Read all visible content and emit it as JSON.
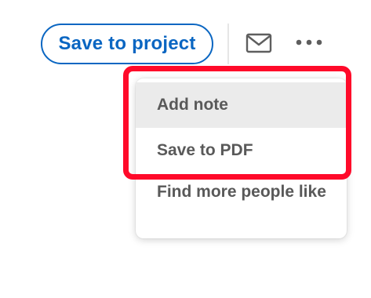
{
  "header": {
    "save_to_project_label": "Save to project",
    "mail_icon": "envelope-icon",
    "more_icon": "more-horizontal-icon"
  },
  "dropdown": {
    "items": [
      {
        "label": "Add note",
        "highlighted": true
      },
      {
        "label": "Save to PDF",
        "highlighted": false
      },
      {
        "label": "Find more people like",
        "highlighted": false
      }
    ]
  },
  "colors": {
    "accent": "#0a66c2",
    "menu_text": "#595959",
    "hover_bg": "#ebebeb",
    "annotation_red": "#ff0a2a"
  }
}
